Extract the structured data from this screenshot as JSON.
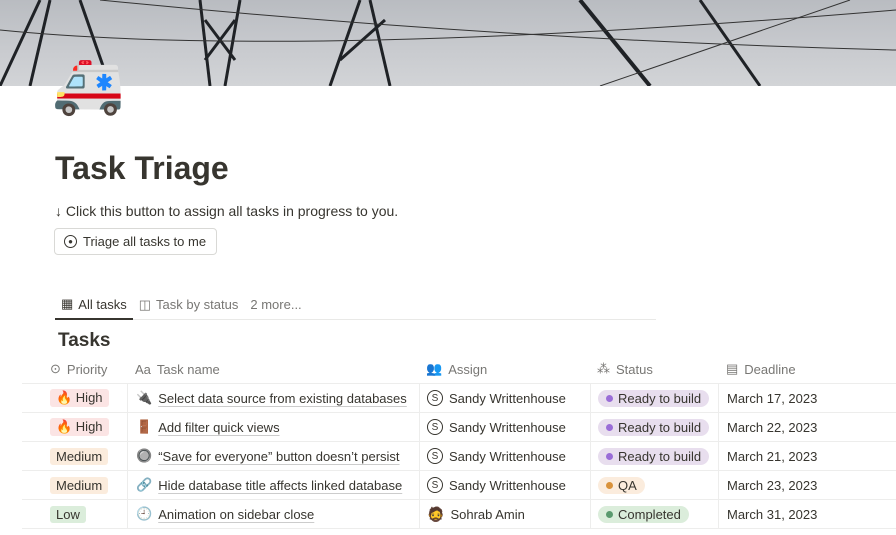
{
  "page": {
    "icon": "🚑",
    "title": "Task Triage",
    "description": "↓ Click this button to assign all tasks in progress to you.",
    "button_label": "Triage all tasks to me"
  },
  "tabs": [
    {
      "label": "All tasks",
      "icon": "table-icon"
    },
    {
      "label": "Task by status",
      "icon": "board-icon"
    },
    {
      "label": "2 more..."
    }
  ],
  "database": {
    "title": "Tasks",
    "columns": [
      "Priority",
      "Task name",
      "Assign",
      "Status",
      "Deadline"
    ]
  },
  "rows": [
    {
      "priority": "🔥 High",
      "priority_color": "#fbe4e4",
      "task_icon": "🔌",
      "task": "Select data source from existing databases",
      "assign": "Sandy Writtenhouse",
      "initial": "S",
      "status": "Ready to build",
      "status_bg": "#e8deee",
      "status_dot": "#9a6dd7",
      "deadline": "March 17, 2023"
    },
    {
      "priority": "🔥 High",
      "priority_color": "#fbe4e4",
      "task_icon": "🚪",
      "task": "Add filter quick views",
      "assign": "Sandy Writtenhouse",
      "initial": "S",
      "status": "Ready to build",
      "status_bg": "#e8deee",
      "status_dot": "#9a6dd7",
      "deadline": "March 22, 2023"
    },
    {
      "priority": "Medium",
      "priority_color": "#fbecdd",
      "task_icon": "🔘",
      "task": "“Save for everyone” button doesn’t persist",
      "assign": "Sandy Writtenhouse",
      "initial": "S",
      "status": "Ready to build",
      "status_bg": "#e8deee",
      "status_dot": "#9a6dd7",
      "deadline": "March 21, 2023"
    },
    {
      "priority": "Medium",
      "priority_color": "#fbecdd",
      "task_icon": "🔗",
      "task": "Hide database title affects linked database",
      "assign": "Sandy Writtenhouse",
      "initial": "S",
      "status": "QA",
      "status_bg": "#fbecdd",
      "status_dot": "#d9923b",
      "deadline": "March 23, 2023"
    },
    {
      "priority": "Low",
      "priority_color": "#dbeddb",
      "task_icon": "🕘",
      "task": "Animation on sidebar close",
      "assign": "Sohrab Amin",
      "initial": "",
      "status": "Completed",
      "status_bg": "#dbeddb",
      "status_dot": "#5a9a6e",
      "deadline": "March 31, 2023"
    }
  ]
}
